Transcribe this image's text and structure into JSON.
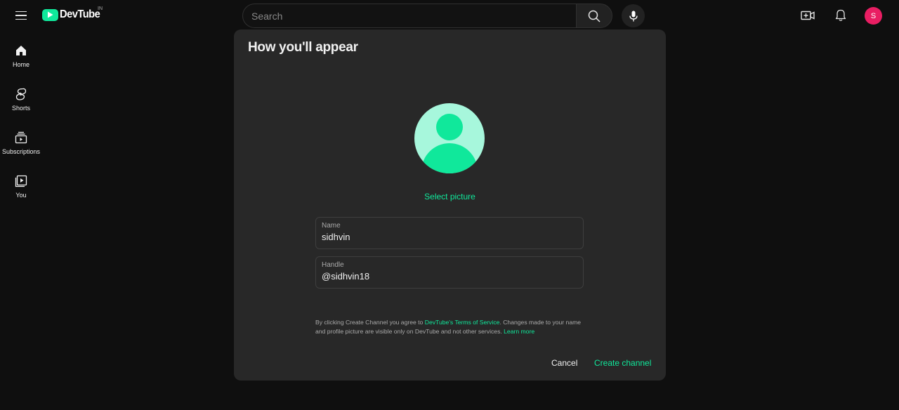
{
  "header": {
    "logo_text": "DevTube",
    "region": "IN",
    "search_placeholder": "Search",
    "avatar_initial": "S"
  },
  "sidebar": {
    "items": [
      {
        "label": "Home",
        "icon": "home-icon"
      },
      {
        "label": "Shorts",
        "icon": "shorts-icon"
      },
      {
        "label": "Subscriptions",
        "icon": "subscriptions-icon"
      },
      {
        "label": "You",
        "icon": "you-icon"
      }
    ]
  },
  "dialog": {
    "title": "How you'll appear",
    "select_picture": "Select picture",
    "name_label": "Name",
    "name_value": "sidhvin",
    "handle_label": "Handle",
    "handle_value": "@sidhvin18",
    "terms_before": "By clicking Create Channel you agree to ",
    "terms_link": "DevTube's Terms of Service",
    "terms_after": ". Changes made to your name and profile picture are visible only on DevTube and not other services. ",
    "learn_more": "Learn more",
    "cancel_label": "Cancel",
    "create_label": "Create channel"
  },
  "colors": {
    "accent": "#10e89b",
    "avatar_bg": "#e91e63",
    "dialog_bg": "#282828",
    "page_bg": "#0f0f0f"
  }
}
